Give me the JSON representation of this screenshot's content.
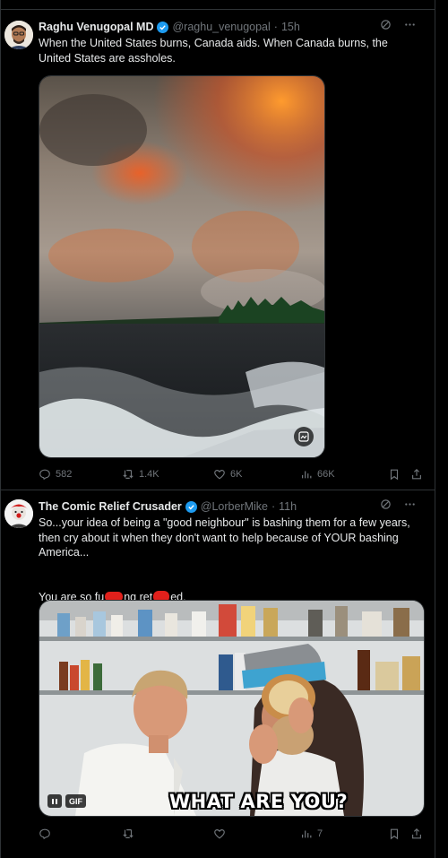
{
  "tweets": [
    {
      "author": "Raghu Venugopal MD",
      "handle": "@raghu_venugopal",
      "separator": "·",
      "time": "15h",
      "text": "When the United States burns, Canada aids. When Canada burns, the United States are assholes.",
      "media_type": "image",
      "stats": {
        "replies": "582",
        "reposts": "1.4K",
        "likes": "6K",
        "views": "66K"
      }
    },
    {
      "author": "The Comic Relief Crusader",
      "handle": "@LorberMike",
      "separator": "·",
      "time": "11h",
      "text": "So...your idea of being a \"good neighbour\" is bashing them for a few years, then cry about it when they don't want to help because of YOUR bashing America...",
      "text2_parts": [
        "You are so fu",
        "ng ret",
        "ed."
      ],
      "media_type": "gif",
      "gif_badge": "GIF",
      "caption": "WHAT ARE YOU?",
      "stats": {
        "replies": "",
        "reposts": "",
        "likes": "",
        "views": "7"
      }
    }
  ],
  "icons": [
    "verified-badge-icon",
    "grok-icon",
    "more-icon",
    "reply-icon",
    "repost-icon",
    "like-icon",
    "views-icon",
    "bookmark-icon",
    "share-icon",
    "alt-text-icon",
    "pause-icon"
  ],
  "colors": {
    "background": "#000000",
    "text": "#e7e9ea",
    "muted": "#71767b",
    "border": "#2f3336",
    "verified": "#1d9bf0",
    "redaction": "#e0201b"
  }
}
